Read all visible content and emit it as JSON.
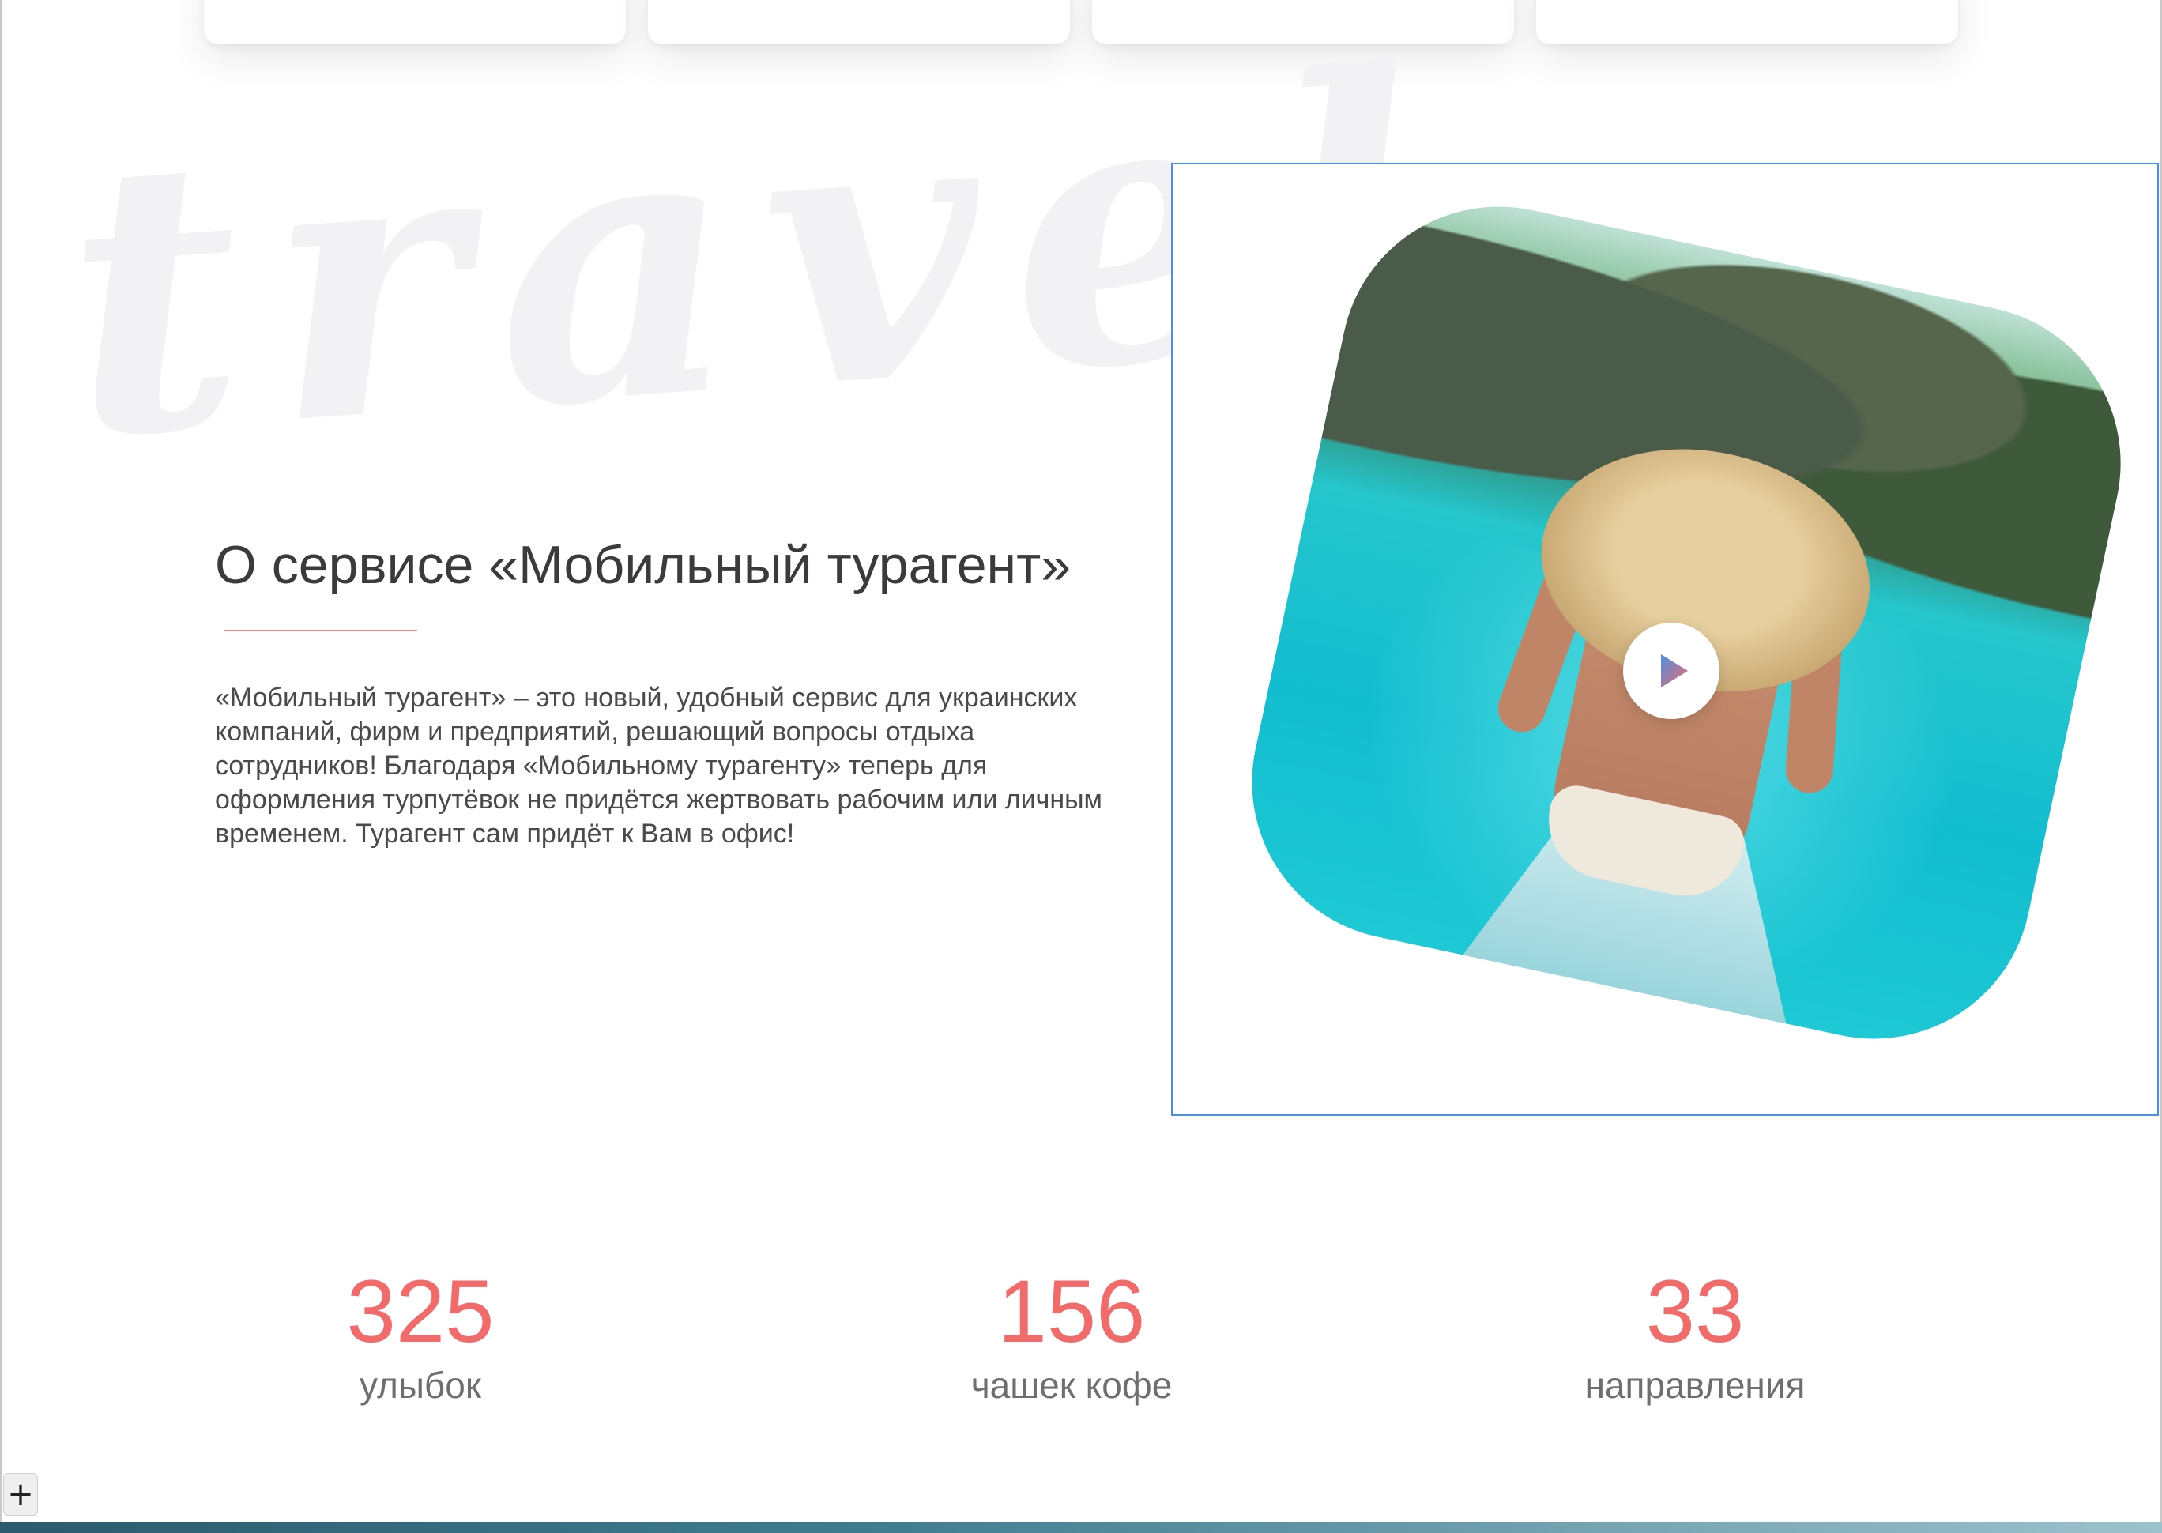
{
  "watermark": "travel",
  "about": {
    "title": "О сервисе «Мобильный турагент»",
    "description": "«Мобильный турагент» – это новый, удобный сервис для украинских компаний, фирм и предприятий, решающий вопросы отдыха сотрудников! Благодаря «Мобильному турагенту» теперь для оформления турпутёвок не придётся жертвовать рабочим или личным временем. Турагент сам придёт к Вам в офис!"
  },
  "video": {
    "play_icon": "play-icon"
  },
  "stats": [
    {
      "value": "325",
      "label": "улыбок"
    },
    {
      "value": "156",
      "label": "чашек кофе"
    },
    {
      "value": "33",
      "label": "направления"
    }
  ],
  "controls": {
    "plus": "+"
  },
  "colors": {
    "accent": "#f26b6b",
    "text": "#3b3b3b",
    "watermark": "#f2f2f4",
    "selection": "#4a90e2"
  }
}
